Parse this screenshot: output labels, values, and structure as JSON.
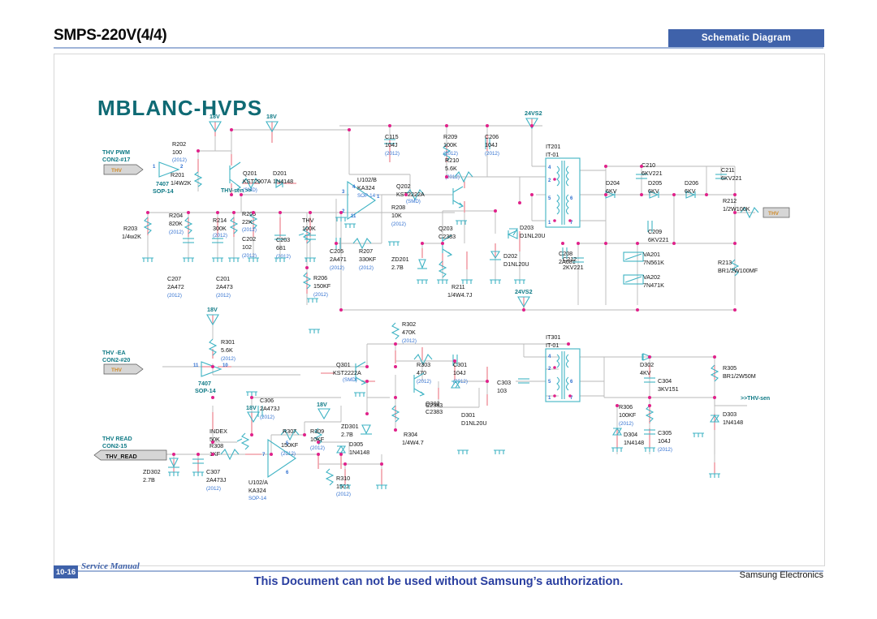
{
  "header": {
    "title": "SMPS-220V(4/4)",
    "badge": "Schematic Diagram"
  },
  "footer": {
    "page_number": "10-16",
    "service_manual": "Service Manual",
    "notice": "This Document can not be used without Samsung’s authorization.",
    "company": "Samsung Electronics"
  },
  "diagram": {
    "block_title": "MBLANC-HVPS",
    "nets": {
      "supply_18v_a": "18V",
      "supply_18v_b": "18V",
      "supply_18v_c": "18V",
      "supply_18v_d": "18V",
      "supply_18v_e": "18V",
      "supply_24vs2_top": "24VS2",
      "supply_24vs2_mid": "24VS2",
      "thv_sen_out": "THV-sen >>",
      "thv_sen_in": ">>THV-sen"
    },
    "connectors": [
      {
        "name": "THV PWM",
        "ref": "CON2-#17",
        "label": "THV"
      },
      {
        "name": "THV -EA",
        "ref": "CON2-#20",
        "label": "THV"
      },
      {
        "name": "THV READ",
        "ref": "CON2-15",
        "label": "THV_READ"
      }
    ],
    "ics": [
      {
        "ref": "U102/B",
        "part": "KA324",
        "pkg": "SOP-14",
        "pins": [
          "3",
          "4",
          "2",
          "1",
          "11"
        ]
      },
      {
        "ref": "U102/A",
        "part": "KA324",
        "pkg": "SOP-14",
        "pins": [
          "7",
          "5",
          "6"
        ]
      },
      {
        "ref": "7407",
        "part": "SOP-14",
        "pkg": "",
        "pins": [
          "1",
          "2"
        ]
      },
      {
        "ref": "7407",
        "part": "SOP-14",
        "pkg": "",
        "pins": [
          "11",
          "10"
        ]
      },
      {
        "ref": "IT201",
        "part": "IT-01",
        "pkg": "",
        "pins": [
          "4",
          "2",
          "5",
          "6",
          "1",
          "7"
        ]
      },
      {
        "ref": "IT301",
        "part": "IT-01",
        "pkg": "",
        "pins": [
          "4",
          "2",
          "5",
          "6",
          "1",
          "7"
        ]
      }
    ],
    "components": [
      {
        "ref": "R202",
        "value": "100",
        "pkg": "(2012)"
      },
      {
        "ref": "R201",
        "value": "1/4W2K",
        "pkg": ""
      },
      {
        "ref": "Q201",
        "value": "KST2907A",
        "pkg": "(SMD)"
      },
      {
        "ref": "D201",
        "value": "1N4148",
        "pkg": ""
      },
      {
        "ref": "R203",
        "value": "1/4w2K",
        "pkg": ""
      },
      {
        "ref": "R204",
        "value": "820K",
        "pkg": "(2012)"
      },
      {
        "ref": "R214",
        "value": "300K",
        "pkg": "(2012)"
      },
      {
        "ref": "R205",
        "value": "22K",
        "pkg": "(2012)"
      },
      {
        "ref": "C202",
        "value": "102",
        "pkg": "(2012)"
      },
      {
        "ref": "C203",
        "value": "681",
        "pkg": "(2012)"
      },
      {
        "ref": "C207",
        "value": "2A472",
        "pkg": "(2012)"
      },
      {
        "ref": "C201",
        "value": "2A473",
        "pkg": "(2012)"
      },
      {
        "ref": "THV",
        "value": "100K",
        "pkg": ""
      },
      {
        "ref": "R206",
        "value": "150KF",
        "pkg": "(2012)"
      },
      {
        "ref": "C205",
        "value": "2A471",
        "pkg": "(2012)"
      },
      {
        "ref": "R207",
        "value": "330KF",
        "pkg": "(2012)"
      },
      {
        "ref": "C115",
        "value": "104J",
        "pkg": "(2012)"
      },
      {
        "ref": "R209",
        "value": "100K",
        "pkg": "(2012)"
      },
      {
        "ref": "C206",
        "value": "104J",
        "pkg": "(2012)"
      },
      {
        "ref": "R210",
        "value": "5.6K",
        "pkg": "(2012)"
      },
      {
        "ref": "R208",
        "value": "10K",
        "pkg": "(2012)"
      },
      {
        "ref": "Q202",
        "value": "KST2222A",
        "pkg": "(SMD)"
      },
      {
        "ref": "Q203",
        "value": "C2383",
        "pkg": ""
      },
      {
        "ref": "ZD201",
        "value": "2.7B",
        "pkg": ""
      },
      {
        "ref": "R211",
        "value": "1/4W4.7J",
        "pkg": ""
      },
      {
        "ref": "D202",
        "value": "D1NL20U",
        "pkg": ""
      },
      {
        "ref": "D203",
        "value": "D1NL20U",
        "pkg": ""
      },
      {
        "ref": "C208",
        "value": "2A681",
        "pkg": ""
      },
      {
        "ref": "C212",
        "value": "2KV221",
        "pkg": ""
      },
      {
        "ref": "D204",
        "value": "6KV",
        "pkg": ""
      },
      {
        "ref": "D205",
        "value": "6KV",
        "pkg": ""
      },
      {
        "ref": "D206",
        "value": "6KV",
        "pkg": ""
      },
      {
        "ref": "C210",
        "value": "6KV221",
        "pkg": ""
      },
      {
        "ref": "C209",
        "value": "6KV221",
        "pkg": ""
      },
      {
        "ref": "C211",
        "value": "6KV221",
        "pkg": ""
      },
      {
        "ref": "R212",
        "value": "1/2W100K",
        "pkg": ""
      },
      {
        "ref": "R213",
        "value": "BR1/2W100MF",
        "pkg": ""
      },
      {
        "ref": "VA201",
        "value": "7N561K",
        "pkg": ""
      },
      {
        "ref": "VA202",
        "value": "7N471K",
        "pkg": ""
      },
      {
        "ref": "R301",
        "value": "5.6K",
        "pkg": "(2012)"
      },
      {
        "ref": "C306",
        "value": "2A473J",
        "pkg": "(2012)"
      },
      {
        "ref": "Q301",
        "value": "KST2222A",
        "pkg": "(SMD)"
      },
      {
        "ref": "R302",
        "value": "470K",
        "pkg": "(2012)"
      },
      {
        "ref": "R303",
        "value": "470",
        "pkg": "(2012)"
      },
      {
        "ref": "C301",
        "value": "104J",
        "pkg": "(2012)"
      },
      {
        "ref": "C302",
        "value": "C2383",
        "pkg": ""
      },
      {
        "ref": "Q302",
        "value": "C2383",
        "pkg": ""
      },
      {
        "ref": "D301",
        "value": "D1NL20U",
        "pkg": ""
      },
      {
        "ref": "ZD301",
        "value": "2.7B",
        "pkg": ""
      },
      {
        "ref": "R304",
        "value": "1/4W4.7",
        "pkg": ""
      },
      {
        "ref": "C303",
        "value": "103",
        "pkg": ""
      },
      {
        "ref": "INDEX",
        "value": "50K",
        "pkg": ""
      },
      {
        "ref": "R307",
        "value": "150KF",
        "pkg": "(2012)"
      },
      {
        "ref": "R309",
        "value": "10KF",
        "pkg": "(2012)"
      },
      {
        "ref": "R308",
        "value": "1KF",
        "pkg": ""
      },
      {
        "ref": "ZD302",
        "value": "2.7B",
        "pkg": ""
      },
      {
        "ref": "C307",
        "value": "2A473J",
        "pkg": "(2012)"
      },
      {
        "ref": "D305",
        "value": "1N4148",
        "pkg": ""
      },
      {
        "ref": "R310",
        "value": "150J",
        "pkg": "(2012)"
      },
      {
        "ref": "D302",
        "value": "4KV",
        "pkg": ""
      },
      {
        "ref": "C304",
        "value": "3KV151",
        "pkg": ""
      },
      {
        "ref": "R305",
        "value": "BR1/2W50M",
        "pkg": ""
      },
      {
        "ref": "R306",
        "value": "100KF",
        "pkg": "(2012)"
      },
      {
        "ref": "D303",
        "value": "1N4148",
        "pkg": ""
      },
      {
        "ref": "D304",
        "value": "1N4148",
        "pkg": ""
      },
      {
        "ref": "C305",
        "value": "104J",
        "pkg": "(2012)"
      }
    ]
  }
}
